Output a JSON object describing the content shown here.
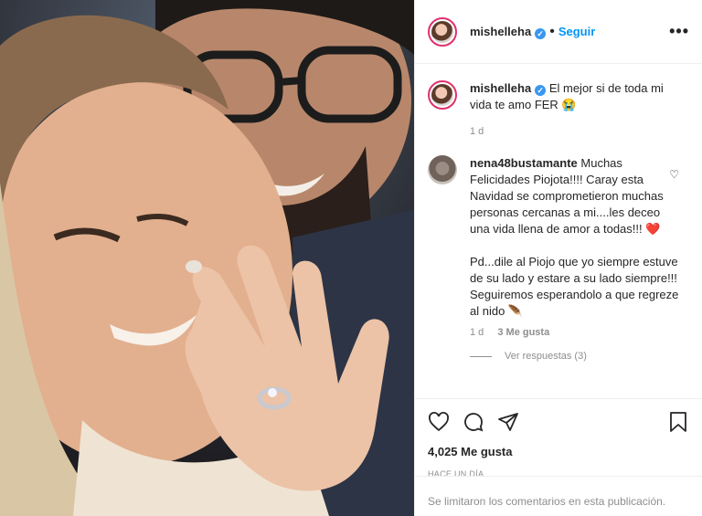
{
  "author": {
    "username": "mishelleha",
    "follow_label": "Seguir"
  },
  "caption": {
    "username": "mishelleha",
    "text": "El mejor si de toda mi vida te amo FER 😭",
    "age": "1 d"
  },
  "comment": {
    "username": "nena48bustamante",
    "text": "Muchas Felicidades Piojota!!!! Caray esta Navidad se comprometieron muchas personas cercanas a mi....les deceo una vida llena de amor a todas!!! ❤️",
    "text2": "Pd...dile al Piojo que yo siempre estuve de su lado y estare a su lado siempre!!! Seguiremos esperandolo a que regreze al nido 🪶",
    "age": "1 d",
    "likes": "3 Me gusta",
    "view_replies": "Ver respuestas (3)"
  },
  "stats": {
    "likes": "4,025 Me gusta",
    "time": "HACE UN DÍA"
  },
  "comments_closed": "Se limitaron los comentarios en esta publicación.",
  "colors": {
    "link": "#0095f6",
    "verified": "#3897f0",
    "heart": "#ed4956"
  }
}
